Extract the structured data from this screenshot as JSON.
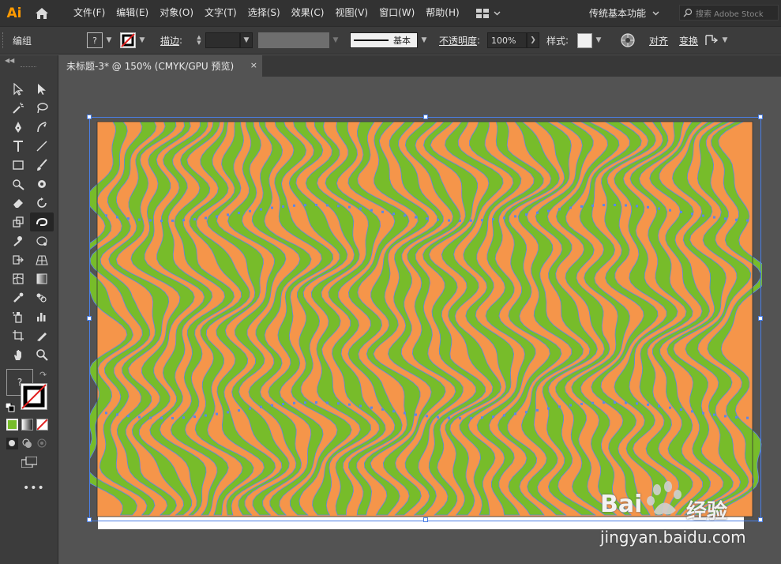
{
  "app": {
    "logo_text": "Ai"
  },
  "menu": [
    "文件(F)",
    "编辑(E)",
    "对象(O)",
    "文字(T)",
    "选择(S)",
    "效果(C)",
    "视图(V)",
    "窗口(W)",
    "帮助(H)"
  ],
  "workspace": {
    "label": "传统基本功能"
  },
  "search": {
    "placeholder": "搜索 Adobe Stock"
  },
  "control": {
    "selection_label": "编组",
    "stroke_label": "描边",
    "stroke_colon": ":",
    "brush_label": "基本",
    "opacity_label": "不透明度",
    "opacity_value": "100%",
    "style_label": "样式",
    "align_label": "对齐",
    "transform_label": "变换"
  },
  "document": {
    "tab_title": "未标题-3* @ 150% (CMYK/GPU 预览)",
    "close": "×"
  },
  "toolbar": {
    "fill_question": "?"
  },
  "artwork": {
    "colors": {
      "orange": "#f5954a",
      "green": "#77bc2a",
      "path": "#5b87e8",
      "selection": "#4a7fe6"
    }
  },
  "watermark": {
    "brand": "Bai",
    "brand_cn": "经验",
    "url": "jingyan.baidu.com"
  }
}
